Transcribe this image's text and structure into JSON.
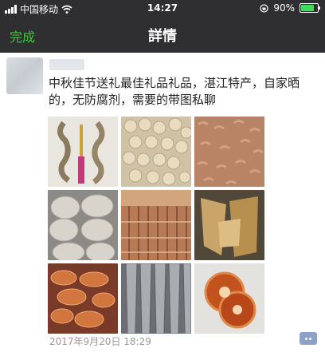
{
  "status_bar": {
    "carrier": "中国移动",
    "time": "14:27",
    "battery": "90%",
    "battery_level": 0.9
  },
  "nav": {
    "back_label": "完成",
    "title": "詳情"
  },
  "post": {
    "text": "中秋佳节送礼最佳礼品礼品，湛江特产，自家晒的，无防腐剂，需要的带图私聊",
    "timestamp": "2017年9月20日 18:29",
    "photos": [
      {
        "name": "photo-dried-seahorses",
        "subject": "dried seahorses"
      },
      {
        "name": "photo-dried-scallops",
        "subject": "dried scallops"
      },
      {
        "name": "photo-dried-shrimp",
        "subject": "dried shrimp"
      },
      {
        "name": "photo-dried-fish-stack",
        "subject": "stacked dried fish"
      },
      {
        "name": "photo-drying-racks",
        "subject": "drying racks"
      },
      {
        "name": "photo-dried-fish-fillets",
        "subject": "dried fish fillets"
      },
      {
        "name": "photo-dried-prawns",
        "subject": "dried prawns"
      },
      {
        "name": "photo-dried-fish-whole",
        "subject": "whole dried fish"
      },
      {
        "name": "photo-dried-fruit-slices",
        "subject": "dried slices"
      }
    ]
  },
  "colors": {
    "nav_background": "#2f2f31",
    "accent_green": "#3ec53e",
    "timestamp_gray": "#999999"
  }
}
